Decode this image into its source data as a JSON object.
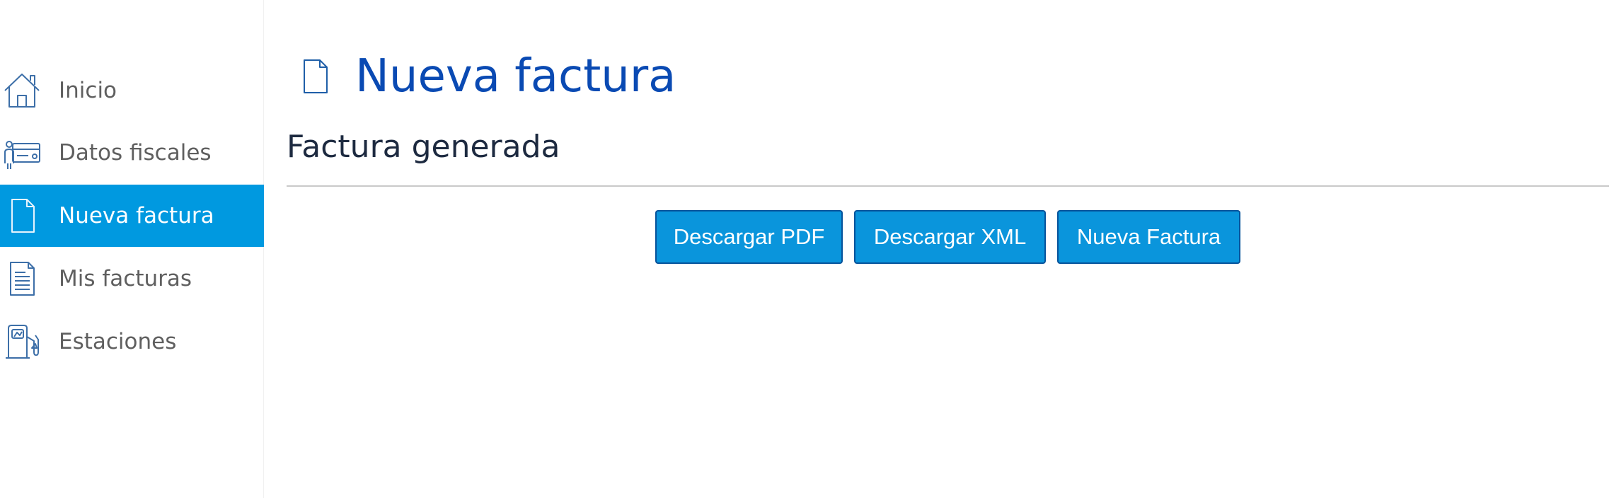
{
  "sidebar": {
    "items": [
      {
        "label": "Inicio",
        "icon": "house-icon"
      },
      {
        "label": "Datos fiscales",
        "icon": "id-card-icon"
      },
      {
        "label": "Nueva factura",
        "icon": "document-icon",
        "active": true
      },
      {
        "label": "Mis facturas",
        "icon": "document-lines-icon"
      },
      {
        "label": "Estaciones",
        "icon": "gas-pump-icon"
      }
    ]
  },
  "main": {
    "title": "Nueva factura",
    "title_icon": "document-icon",
    "section_title": "Factura generada",
    "buttons": {
      "pdf": "Descargar PDF",
      "xml": "Descargar XML",
      "nueva": "Nueva Factura"
    }
  },
  "colors": {
    "accent": "#0099e0",
    "title": "#0a4ab3",
    "button": "#0a95dc",
    "button_border": "#06539b",
    "icon_stroke": "#1f5fa8"
  }
}
